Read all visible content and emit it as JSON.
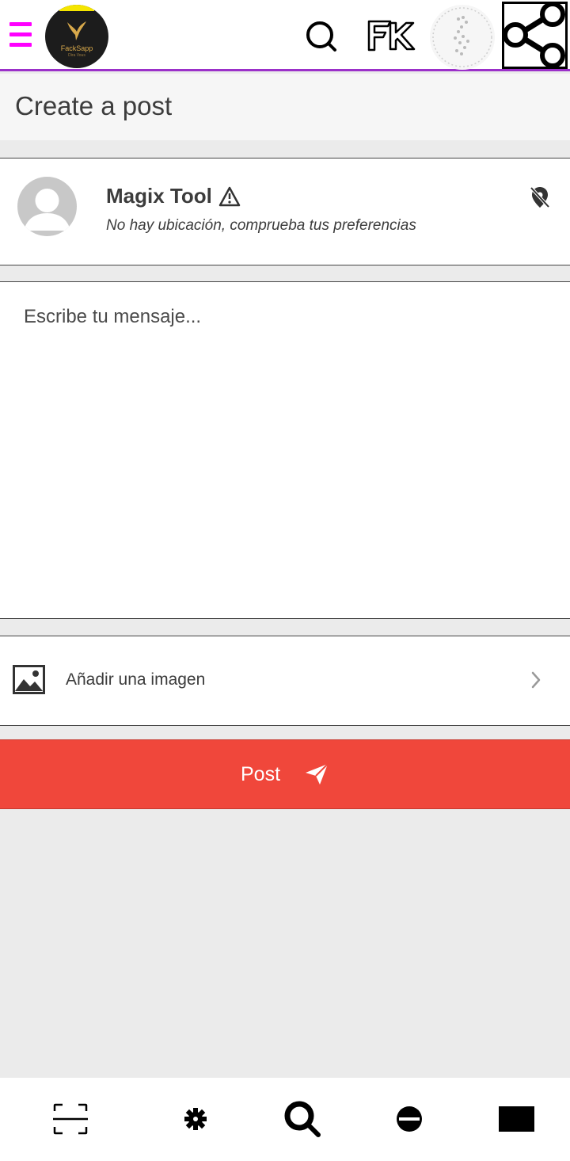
{
  "app": {
    "logo_name": "FackSapp",
    "logo_tagline": "Dira Vous"
  },
  "header": {
    "title": "Create a post"
  },
  "user": {
    "name": "Magix Tool",
    "location_status": "No hay ubicación, comprueba tus preferencias"
  },
  "composer": {
    "placeholder": "Escribe tu mensaje..."
  },
  "attachment": {
    "label": "Añadir una imagen"
  },
  "post_button": {
    "label": "Post"
  },
  "colors": {
    "menu_accent": "#ff00ff",
    "topbar_border": "#9b30c9",
    "post_button": "#f0473b",
    "background": "#ebebeb"
  },
  "icons": {
    "top": [
      "menu-icon",
      "app-logo",
      "search-icon",
      "fk-logo-icon",
      "profile-avatar",
      "share-icon"
    ],
    "user_card": [
      "avatar",
      "warning-icon",
      "location-off-icon"
    ],
    "attachment": [
      "image-icon",
      "chevron-right-icon"
    ],
    "post": [
      "send-icon"
    ],
    "bottom_nav": [
      "scan-icon",
      "gear-icon",
      "search-icon",
      "chat-icon",
      "window-icon"
    ]
  }
}
